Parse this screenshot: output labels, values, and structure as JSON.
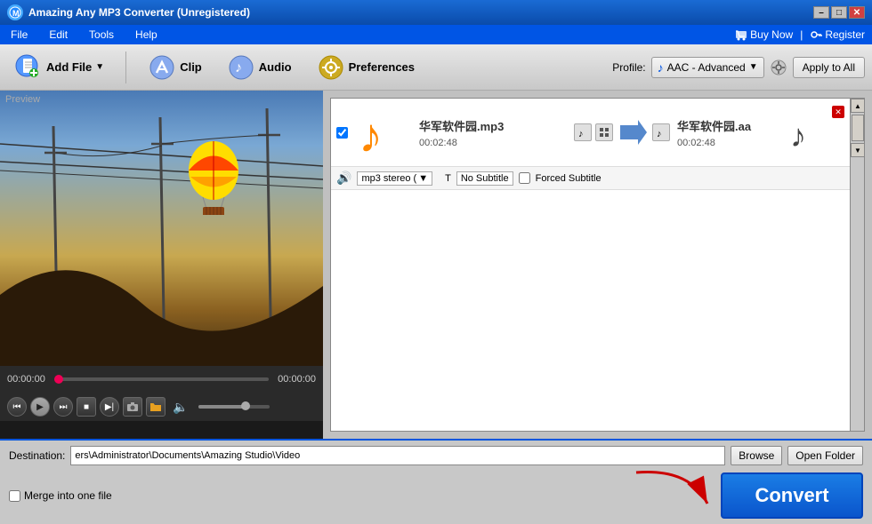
{
  "titlebar": {
    "title": "Amazing Any MP3 Converter (Unregistered)",
    "min_btn": "–",
    "max_btn": "□",
    "close_btn": "✕"
  },
  "menubar": {
    "items": [
      "File",
      "Edit",
      "Tools",
      "Help"
    ],
    "buy_label": "Buy Now",
    "register_label": "Register"
  },
  "toolbar": {
    "add_file_label": "Add File",
    "clip_label": "Clip",
    "audio_label": "Audio",
    "preferences_label": "Preferences",
    "profile_label": "Profile:",
    "profile_value": "AAC - Advanced",
    "apply_all_label": "Apply to All"
  },
  "preview": {
    "label": "Preview"
  },
  "transport": {
    "time_left": "00:00:00",
    "time_right": "00:00:00"
  },
  "file_item": {
    "checkbox": true,
    "input_filename": "华军软件园.mp3",
    "input_duration": "00:02:48",
    "output_filename": "华军软件园.aa",
    "output_duration": "00:02:48",
    "audio_track": "mp3 stereo (",
    "subtitle_label": "No Subtitle",
    "forced_subtitle_label": "Forced Subtitle"
  },
  "bottom": {
    "destination_label": "Destination:",
    "destination_value": "ers\\Administrator\\Documents\\Amazing Studio\\Video",
    "browse_label": "Browse",
    "open_folder_label": "Open Folder",
    "merge_label": "Merge into one file",
    "convert_label": "Convert"
  }
}
